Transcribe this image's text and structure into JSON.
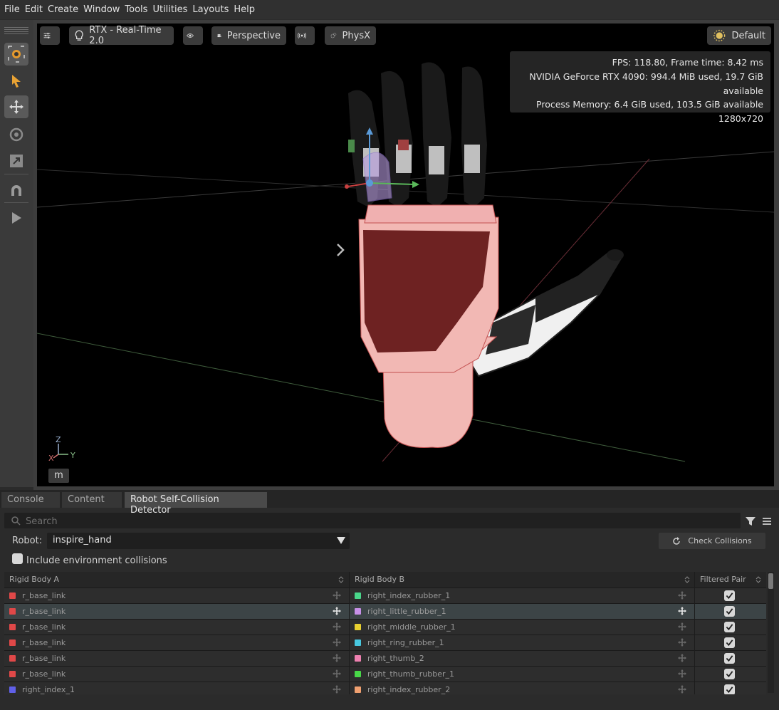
{
  "menu": [
    "File",
    "Edit",
    "Create",
    "Window",
    "Tools",
    "Utilities",
    "Layouts",
    "Help"
  ],
  "viewport": {
    "renderer_label": "RTX - Real-Time 2.0",
    "camera_label": "Perspective",
    "physics_label": "PhysX",
    "lighting_label": "Default",
    "stats": {
      "fps_line": "FPS: 118.80, Frame time: 8.42 ms",
      "gpu_line": "NVIDIA GeForce RTX 4090: 994.4 MiB used, 19.7 GiB available",
      "mem_line": "Process Memory: 6.4 GiB used, 103.5 GiB available",
      "resolution": "1280x720"
    },
    "axis": {
      "z": "Z",
      "x": "X",
      "y": "Y"
    },
    "units_button": "m"
  },
  "tabs": [
    "Console",
    "Content",
    "Robot Self-Collision Detector"
  ],
  "search": {
    "placeholder": "Search"
  },
  "robot": {
    "label": "Robot:",
    "value": "inspire_hand"
  },
  "check_button": "Check Collisions",
  "env_collisions_label": "Include environment collisions",
  "table": {
    "headers": {
      "a": "Rigid Body  A",
      "b": "Rigid Body  B",
      "filtered": "Filtered Pair"
    },
    "rows": [
      {
        "a": "r_base_link",
        "a_color": "#e04848",
        "b": "right_index_rubber_1",
        "b_color": "#49d68a",
        "filtered": true
      },
      {
        "a": "r_base_link",
        "a_color": "#e04848",
        "b": "right_little_rubber_1",
        "b_color": "#c890e8",
        "filtered": true
      },
      {
        "a": "r_base_link",
        "a_color": "#e04848",
        "b": "right_middle_rubber_1",
        "b_color": "#e8d030",
        "filtered": true
      },
      {
        "a": "r_base_link",
        "a_color": "#e04848",
        "b": "right_ring_rubber_1",
        "b_color": "#48c8e0",
        "filtered": true
      },
      {
        "a": "r_base_link",
        "a_color": "#e04848",
        "b": "right_thumb_2",
        "b_color": "#ee80b0",
        "filtered": true
      },
      {
        "a": "r_base_link",
        "a_color": "#e04848",
        "b": "right_thumb_rubber_1",
        "b_color": "#48d848",
        "filtered": true
      },
      {
        "a": "right_index_1",
        "a_color": "#6060e8",
        "b": "right_index_rubber_2",
        "b_color": "#f0a070",
        "filtered": true
      }
    ]
  }
}
